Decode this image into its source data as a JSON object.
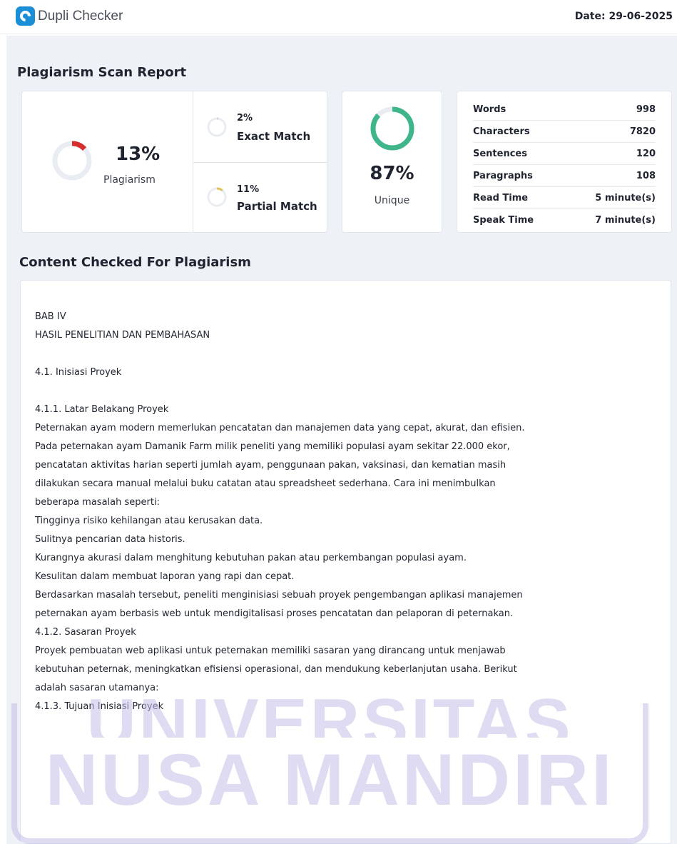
{
  "header": {
    "logo_text": "Dupli Checker",
    "date": "Date: 29-06-2025"
  },
  "report": {
    "title": "Plagiarism Scan Report",
    "plagiarism_pct": "13%",
    "plagiarism_label": "Plagiarism",
    "plagiarism_value": 0.13,
    "exact_pct": "2%",
    "exact_label": "Exact Match",
    "exact_value": 0.02,
    "partial_pct": "11%",
    "partial_label": "Partial Match",
    "partial_value": 0.11,
    "unique_pct": "87%",
    "unique_label": "Unique",
    "unique_value": 0.87,
    "colors": {
      "plagiarism": "#d62d2d",
      "unique": "#3fb58a",
      "partial": "#e0c25a",
      "exact": "#c9cdd4",
      "track": "#e9edf3"
    }
  },
  "stats": [
    {
      "label": "Words",
      "value": "998"
    },
    {
      "label": "Characters",
      "value": "7820"
    },
    {
      "label": "Sentences",
      "value": "120"
    },
    {
      "label": "Paragraphs",
      "value": "108"
    },
    {
      "label": "Read Time",
      "value": "5 minute(s)"
    },
    {
      "label": "Speak Time",
      "value": "7 minute(s)"
    }
  ],
  "content": {
    "title": "Content Checked For Plagiarism",
    "lines": [
      "BAB IV",
      "HASIL PENELITIAN DAN PEMBAHASAN",
      "",
      "4.1. Inisiasi Proyek",
      "",
      "4.1.1. Latar Belakang Proyek",
      "Peternakan ayam modern memerlukan pencatatan dan manajemen data yang cepat, akurat, dan efisien.",
      "Pada peternakan ayam Damanik Farm milik peneliti yang memiliki populasi ayam sekitar 22.000 ekor,",
      "pencatatan aktivitas harian seperti jumlah ayam, penggunaan pakan, vaksinasi, dan kematian masih",
      "dilakukan secara manual melalui buku catatan atau spreadsheet sederhana. Cara ini menimbulkan",
      "beberapa masalah seperti:",
      "Tingginya risiko kehilangan atau kerusakan data.",
      "Sulitnya pencarian data historis.",
      "Kurangnya akurasi dalam menghitung kebutuhan pakan atau perkembangan populasi ayam.",
      "Kesulitan dalam membuat laporan yang rapi dan cepat.",
      "Berdasarkan masalah tersebut, peneliti menginisiasi sebuah proyek pengembangan aplikasi manajemen",
      "peternakan ayam berbasis web untuk mendigitalisasi proses pencatatan dan pelaporan di peternakan.",
      "4.1.2. Sasaran Proyek",
      "Proyek pembuatan web aplikasi untuk peternakan memiliki sasaran yang dirancang untuk menjawab",
      "kebutuhan peternak, meningkatkan efisiensi operasional, dan mendukung keberlanjutan usaha. Berikut",
      "adalah sasaran utamanya:",
      "4.1.3. Tujuan Inisiasi Proyek"
    ]
  },
  "watermark": {
    "line1": "UNIVERSITAS",
    "line2": "NUSA MANDIRI"
  }
}
